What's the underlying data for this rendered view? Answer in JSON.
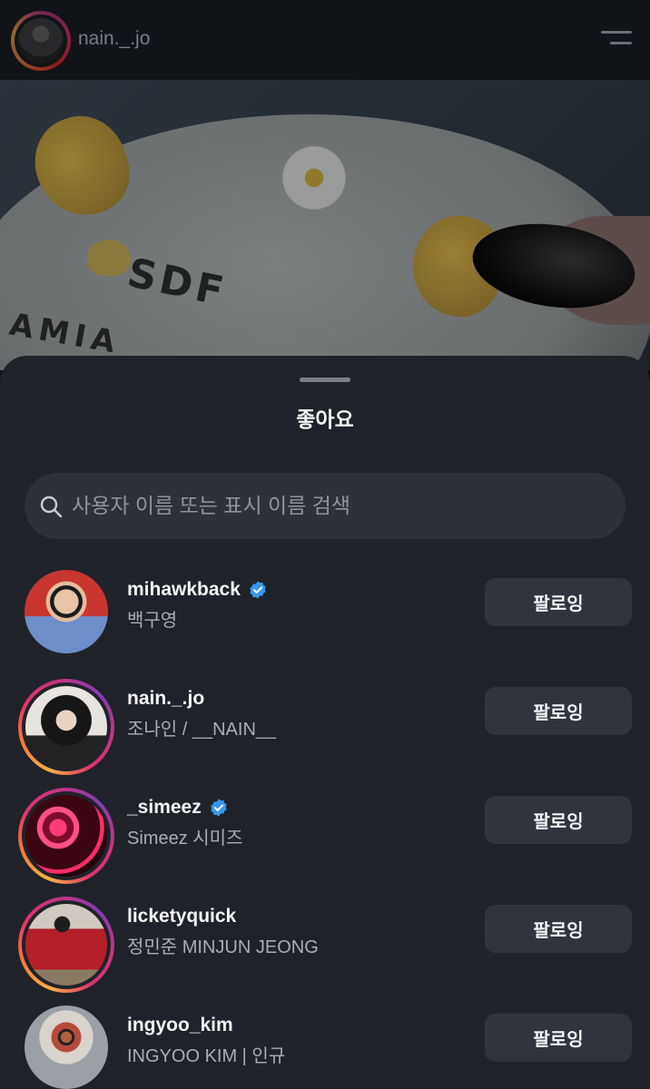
{
  "header": {
    "username": "nain._.jo"
  },
  "photo": {
    "lettering_line1": "SDF",
    "lettering_line2": "AMIA"
  },
  "sheet": {
    "title": "좋아요",
    "search_placeholder": "사용자 이름 또는 표시 이름 검색"
  },
  "users": [
    {
      "username": "mihawkback",
      "display_name": "백구영",
      "verified": true,
      "story_ring": false,
      "button_label": "팔로잉"
    },
    {
      "username": "nain._.jo",
      "display_name": "조나인 / __NAIN__",
      "verified": false,
      "story_ring": true,
      "button_label": "팔로잉"
    },
    {
      "username": "_simeez",
      "display_name": "Simeez 시미즈",
      "verified": true,
      "story_ring": true,
      "button_label": "팔로잉"
    },
    {
      "username": "licketyquick",
      "display_name": "정민준 MINJUN JEONG",
      "verified": false,
      "story_ring": true,
      "button_label": "팔로잉"
    },
    {
      "username": "ingyoo_kim",
      "display_name": "INGYOO KIM | 인규",
      "verified": false,
      "story_ring": false,
      "button_label": "팔로잉"
    }
  ],
  "colors": {
    "sheet_bg": "#1f2329",
    "button_bg": "#30353d",
    "verified_blue": "#3897f0"
  }
}
